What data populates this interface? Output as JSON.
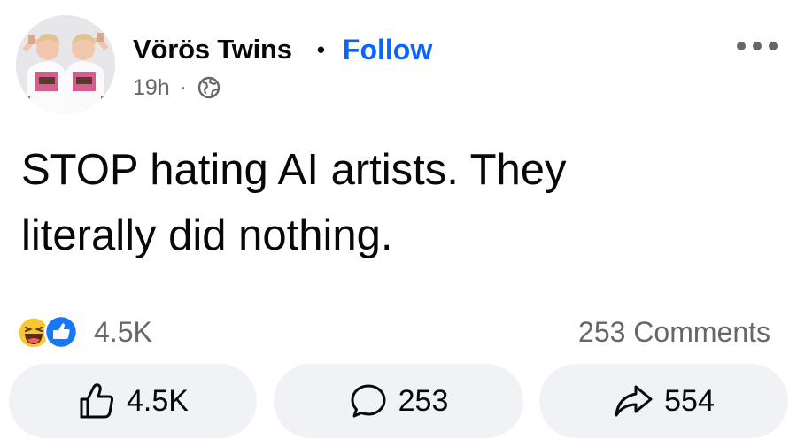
{
  "post": {
    "author": {
      "name": "Vörös Twins",
      "separator": "•",
      "follow_label": "Follow"
    },
    "meta": {
      "time": "19h",
      "separator": "·",
      "privacy_icon": "globe-icon"
    },
    "more_icon": "more-options-icon",
    "text_line1": "STOP hating AI artists. They",
    "text_line2": "literally did nothing."
  },
  "engagement": {
    "reaction_icons": [
      "haha-icon",
      "like-icon"
    ],
    "reaction_count": "4.5K",
    "comments_label": "253 Comments"
  },
  "actions": {
    "like": {
      "icon": "thumbs-up-icon",
      "label": "4.5K"
    },
    "comment": {
      "icon": "speech-bubble-icon",
      "label": "253"
    },
    "share": {
      "icon": "share-arrow-icon",
      "label": "554"
    }
  },
  "colors": {
    "accent": "#0866ff",
    "text": "#080809",
    "secondary_text": "#65676b",
    "button_background": "#f0f2f5"
  }
}
